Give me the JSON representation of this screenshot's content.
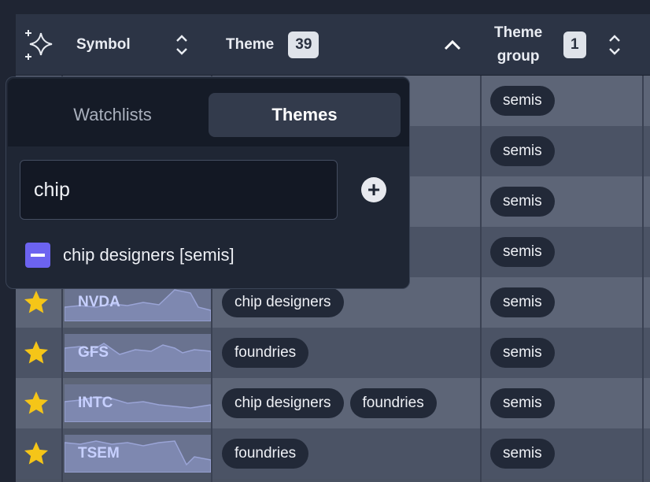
{
  "header": {
    "ai_icon": "sparkles-icon",
    "symbol_label": "Symbol",
    "theme_label": "Theme",
    "theme_count": "39",
    "theme_group_label_line1": "Theme",
    "theme_group_label_line2": "group",
    "theme_group_count": "1"
  },
  "popup": {
    "tabs": [
      {
        "label": "Watchlists",
        "active": false
      },
      {
        "label": "Themes",
        "active": true
      }
    ],
    "search_value": "chip",
    "add_icon": "plus-circle-icon",
    "results": [
      {
        "label": "chip designers [semis]",
        "state": "indeterminate"
      }
    ]
  },
  "rows": [
    {
      "symbol": "",
      "themes": [],
      "group": "semis",
      "starred": false
    },
    {
      "symbol": "",
      "themes": [],
      "group": "semis",
      "starred": false
    },
    {
      "symbol": "",
      "themes": [],
      "group": "semis",
      "starred": false
    },
    {
      "symbol": "",
      "themes": [],
      "group": "semis",
      "starred": false
    },
    {
      "symbol": "NVDA",
      "themes": [
        "chip designers"
      ],
      "group": "semis",
      "starred": true
    },
    {
      "symbol": "GFS",
      "themes": [
        "foundries"
      ],
      "group": "semis",
      "starred": true
    },
    {
      "symbol": "INTC",
      "themes": [
        "chip designers",
        "foundries"
      ],
      "group": "semis",
      "starred": true
    },
    {
      "symbol": "TSEM",
      "themes": [
        "foundries"
      ],
      "group": "semis",
      "starred": true
    }
  ],
  "colors": {
    "accent": "#6c63f0",
    "star": "#f5c518",
    "symbol_text": "#c7d0ff"
  }
}
